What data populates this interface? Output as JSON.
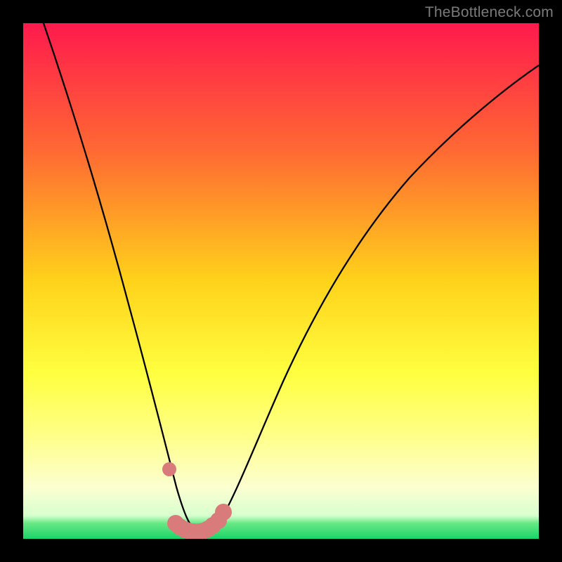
{
  "watermark": "TheBottleneck.com",
  "chart_data": {
    "type": "line",
    "title": "",
    "xlabel": "",
    "ylabel": "",
    "xlim": [
      0,
      100
    ],
    "ylim": [
      0,
      100
    ],
    "background_gradient": {
      "stops": [
        {
          "pos": 0.0,
          "color": "#ff1a4d"
        },
        {
          "pos": 0.25,
          "color": "#ff6a33"
        },
        {
          "pos": 0.5,
          "color": "#ffd21a"
        },
        {
          "pos": 0.68,
          "color": "#ffff40"
        },
        {
          "pos": 0.8,
          "color": "#ffff88"
        },
        {
          "pos": 0.9,
          "color": "#fcffd0"
        },
        {
          "pos": 0.955,
          "color": "#d8ffcf"
        },
        {
          "pos": 0.97,
          "color": "#66e884"
        },
        {
          "pos": 1.0,
          "color": "#1ad46a"
        }
      ]
    },
    "series": [
      {
        "name": "bottleneck-curve",
        "color": "#000000",
        "x": [
          4,
          6,
          8,
          10,
          12,
          14,
          16,
          18,
          20,
          22,
          24,
          26,
          28,
          29,
          30,
          31,
          32,
          33,
          34,
          35,
          36,
          38,
          40,
          44,
          48,
          52,
          56,
          60,
          64,
          68,
          72,
          76,
          80,
          84,
          88,
          92,
          96,
          100
        ],
        "y": [
          100,
          93,
          86,
          79,
          73,
          67,
          61,
          55,
          49,
          43,
          37,
          31,
          24,
          20,
          15,
          9,
          5,
          2,
          1,
          1,
          2,
          6,
          12,
          22,
          30,
          37,
          43,
          49,
          54,
          58,
          62,
          66,
          69,
          72,
          75,
          78,
          80,
          82
        ]
      },
      {
        "name": "critical-markers",
        "color": "#d97b7b",
        "type": "scatter",
        "x": [
          28.3,
          29.5,
          30.4,
          31.3,
          32.2,
          33.1,
          34.0,
          34.9,
          35.8,
          36.8,
          37.8,
          38.8
        ],
        "y": [
          13.5,
          3.0,
          2.3,
          1.8,
          1.5,
          1.3,
          1.3,
          1.5,
          1.9,
          2.6,
          3.6,
          5.2
        ]
      }
    ],
    "minimum_at_x": 34
  }
}
